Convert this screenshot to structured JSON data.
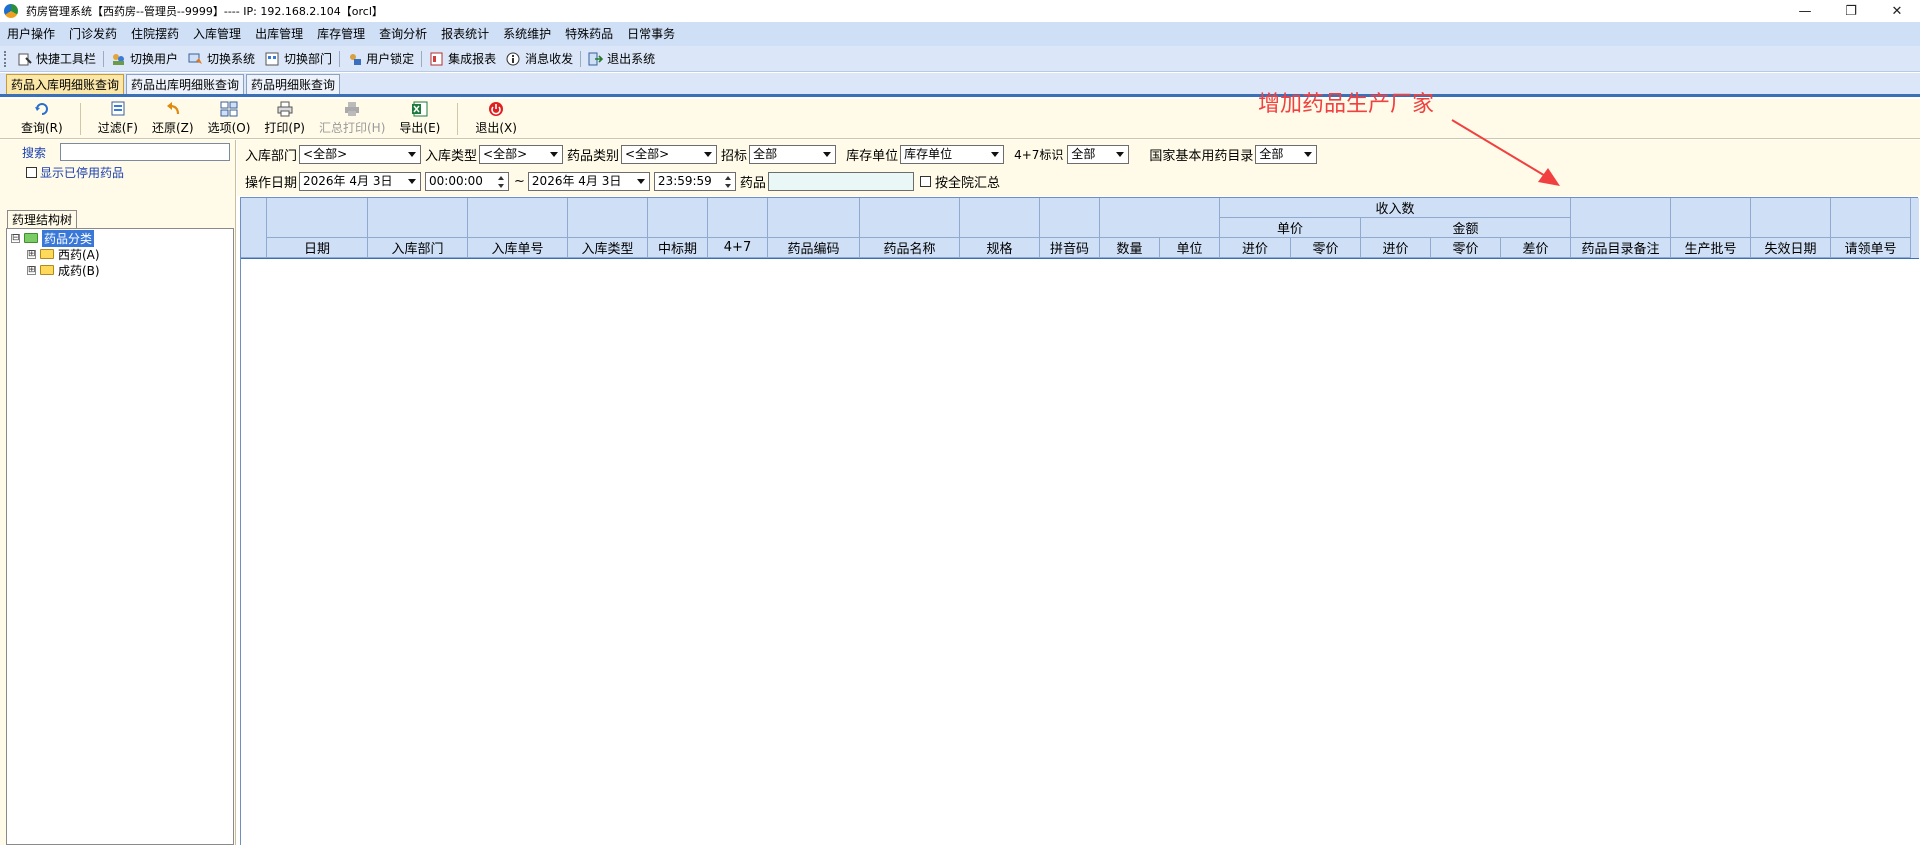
{
  "window": {
    "title": "药房管理系统【西药房--管理员--9999】---- IP: 192.168.2.104【orcl】",
    "minimize": "—",
    "restore": "❐",
    "close": "✕"
  },
  "menu": [
    "用户操作",
    "门诊发药",
    "住院摆药",
    "入库管理",
    "出库管理",
    "库存管理",
    "查询分析",
    "报表统计",
    "系统维护",
    "特殊药品",
    "日常事务"
  ],
  "quickbar": [
    "快捷工具栏",
    "切换用户",
    "切换系统",
    "切换部门",
    "用户锁定",
    "集成报表",
    "消息收发",
    "退出系统"
  ],
  "tabs": [
    "药品入库明细账查询",
    "药品出库明细账查询",
    "药品明细账查询"
  ],
  "actions": {
    "query": "查询(R)",
    "filter": "过滤(F)",
    "restore": "还原(Z)",
    "options": "选项(O)",
    "print": "打印(P)",
    "summary_print": "汇总打印(H)",
    "export": "导出(E)",
    "exit": "退出(X)"
  },
  "left": {
    "search_label": "搜索",
    "search_value": "",
    "show_disabled": "显示已停用药品",
    "tree_tab": "药理结构树",
    "tree": {
      "root": "药品分类",
      "children": [
        "西药(A)",
        "成药(B)"
      ],
      "expand": "⊟",
      "collapsed": "⊞"
    }
  },
  "filters": {
    "dept_label": "入库部门",
    "dept_value": "<全部>",
    "type_label": "入库类型",
    "type_value": "<全部>",
    "category_label": "药品类别",
    "category_value": "<全部>",
    "bid_label": "招标",
    "bid_value": "全部",
    "unit_label": "库存单位",
    "unit_value": "库存单位",
    "flag47_label": "4+7标识",
    "flag47_value": "全部",
    "national_label": "国家基本用药目录",
    "national_value": "全部",
    "date_label": "操作日期",
    "date_from": "2026年 4月 3日",
    "time_from": "00:00:00",
    "tilde": "~",
    "date_to": "2026年 4月 3日",
    "time_to": "23:59:59",
    "drug_label": "药品",
    "drug_value": "",
    "hospital_summary": "按全院汇总"
  },
  "grid": {
    "group_top": "收入数",
    "group_unit_price": "单价",
    "group_amount": "金额",
    "columns": [
      "",
      "日期",
      "入库部门",
      "入库单号",
      "入库类型",
      "中标期",
      "4+7",
      "药品编码",
      "药品名称",
      "规格",
      "拼音码",
      "数量",
      "单位",
      "进价",
      "零价",
      "进价",
      "零价",
      "差价",
      "药品目录备注",
      "生产批号",
      "失效日期",
      "请领单号"
    ]
  },
  "annotation": {
    "text": "增加药品生产厂家",
    "color": "#f04040"
  }
}
